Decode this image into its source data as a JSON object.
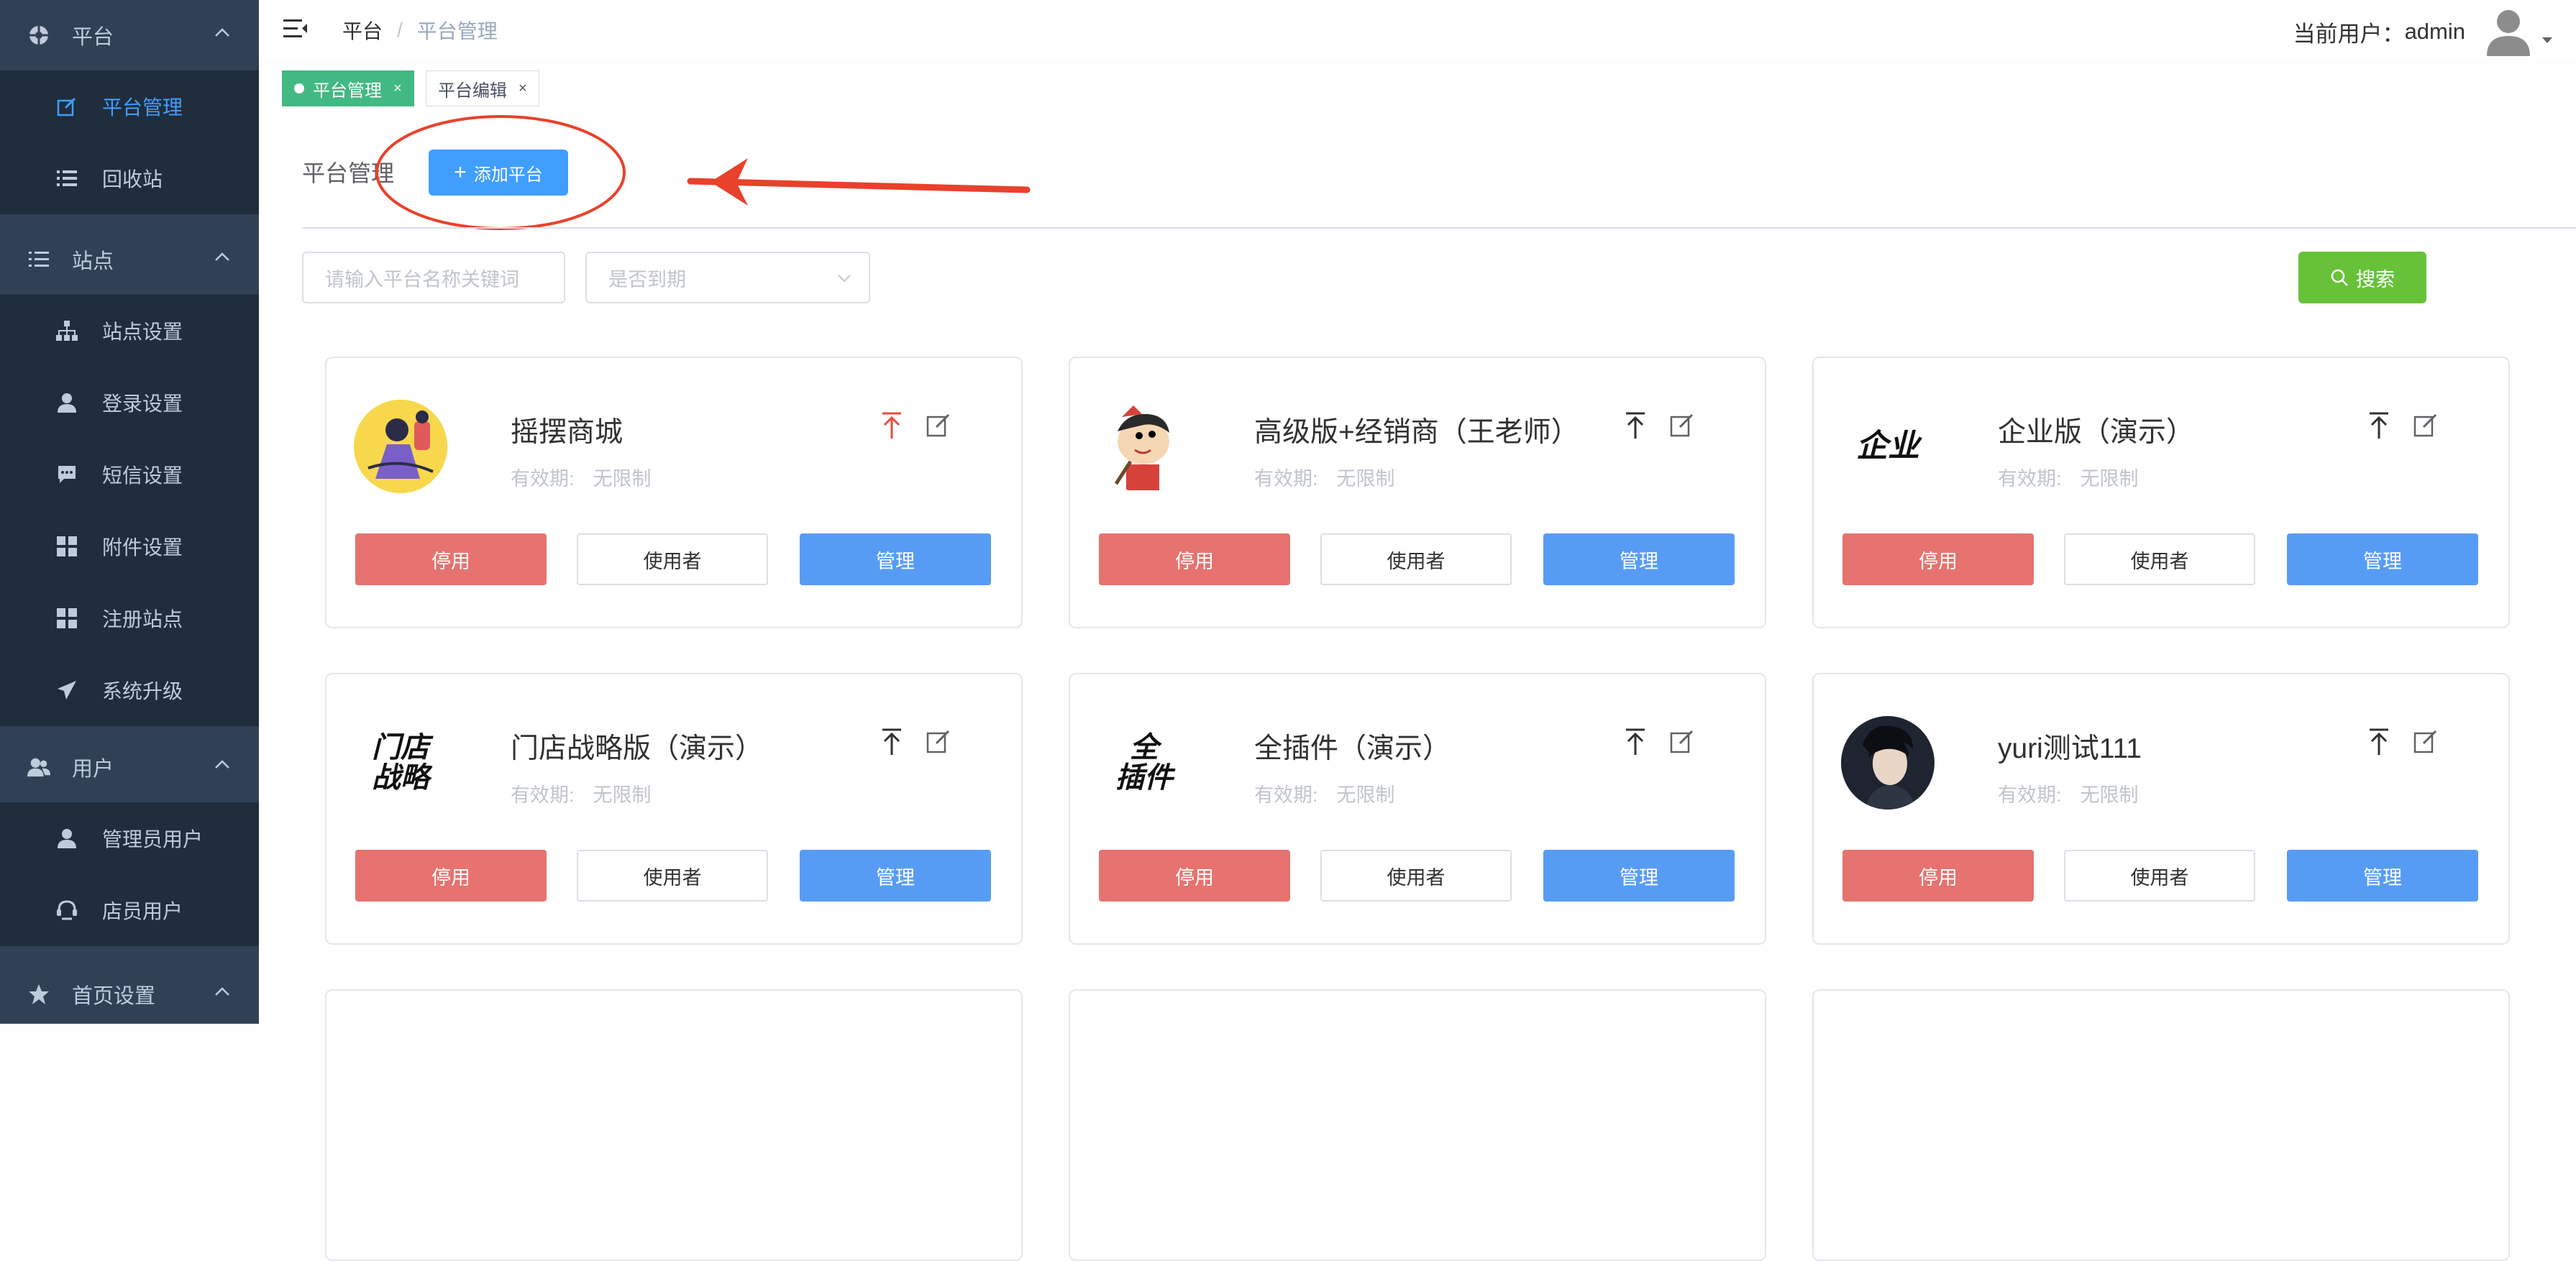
{
  "sidebar": {
    "groups": [
      {
        "label": "平台",
        "icon": "aperture-icon",
        "items": [
          {
            "label": "平台管理",
            "icon": "edit-icon",
            "active": true
          },
          {
            "label": "回收站",
            "icon": "list-icon",
            "active": false
          }
        ]
      },
      {
        "label": "站点",
        "icon": "list-icon",
        "items": [
          {
            "label": "站点设置",
            "icon": "sitemap-icon"
          },
          {
            "label": "登录设置",
            "icon": "user-icon"
          },
          {
            "label": "短信设置",
            "icon": "message-icon"
          },
          {
            "label": "附件设置",
            "icon": "grid-icon"
          },
          {
            "label": "注册站点",
            "icon": "grid-icon"
          },
          {
            "label": "系统升级",
            "icon": "send-icon"
          }
        ]
      },
      {
        "label": "用户",
        "icon": "users-icon",
        "items": [
          {
            "label": "管理员用户",
            "icon": "user-icon"
          },
          {
            "label": "店员用户",
            "icon": "staff-icon"
          }
        ]
      },
      {
        "label": "首页设置",
        "icon": "star-icon",
        "items": []
      }
    ]
  },
  "header": {
    "breadcrumb": [
      "平台",
      "平台管理"
    ],
    "separator": "/",
    "current_user_label": "当前用户：",
    "username": "admin"
  },
  "tags": [
    {
      "label": "平台管理",
      "active": true,
      "close": "×"
    },
    {
      "label": "平台编辑",
      "active": false,
      "close": "×"
    }
  ],
  "main": {
    "title": "平台管理",
    "add_button": "添加平台",
    "search_placeholder": "请输入平台名称关键词",
    "expire_select_placeholder": "是否到期",
    "search_button": "搜索",
    "valid_label": "有效期:",
    "valid_value": "无限制",
    "actions": {
      "disable": "停用",
      "users": "使用者",
      "manage": "管理"
    },
    "cards": [
      {
        "name": "摇摆商城",
        "logo": "cartoon-avatar-yellow",
        "top_highlight": true
      },
      {
        "name": "高级版+经销商（王老师）",
        "logo": "cartoon-avatar-boy",
        "top_highlight": false
      },
      {
        "name": "企业版（演示）",
        "logo_text": "企业",
        "top_highlight": false
      },
      {
        "name": "门店战略版（演示）",
        "logo_text": "门店\n战略",
        "top_highlight": false
      },
      {
        "name": "全插件（演示）",
        "logo_text": "全\n插件",
        "top_highlight": false
      },
      {
        "name": "yuri测试111",
        "logo": "photo-avatar",
        "top_highlight": false
      }
    ]
  },
  "colors": {
    "sidebar_bg": "#304156",
    "sidebar_sub_bg": "#1f2d3d",
    "active_blue": "#409eff",
    "tag_green": "#42b983",
    "search_green": "#67c23a",
    "disable_red": "#e6736f",
    "manage_blue": "#579cf4",
    "annotation_red": "#e8412c"
  }
}
